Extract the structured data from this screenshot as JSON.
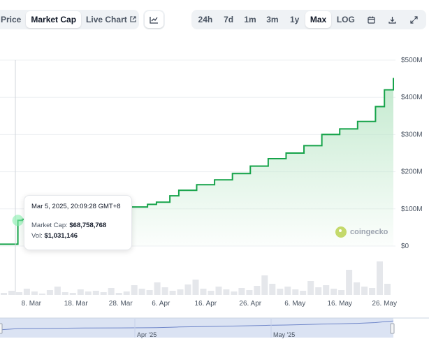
{
  "toolbar": {
    "left_tabs": [
      "Price",
      "Market Cap",
      "Live Chart"
    ],
    "active_left": "Market Cap",
    "ranges": [
      "24h",
      "7d",
      "1m",
      "3m",
      "1y",
      "Max",
      "LOG"
    ],
    "active_range": "Max",
    "icons": [
      "line-chart-icon",
      "calendar-icon",
      "download-icon",
      "expand-icon"
    ]
  },
  "tooltip": {
    "date": "Mar 5, 2025, 20:09:28 GMT+8",
    "market_cap_label": "Market Cap:",
    "market_cap_value": "$68,758,768",
    "vol_label": "Vol:",
    "vol_value": "$1,031,146"
  },
  "watermark": "coingecko",
  "colors": {
    "line": "#16a34a",
    "fill_top": "#bfe8cb",
    "volume": "#e5e7eb",
    "navigator": "#dbe3f3",
    "navigator_line": "#6f86c9"
  },
  "chart_data": {
    "type": "area",
    "title": "",
    "xlabel": "",
    "ylabel": "",
    "y_ticks": [
      "$500M",
      "$400M",
      "$300M",
      "$200M",
      "$100M",
      "$0"
    ],
    "x_ticks": [
      "8. Mar",
      "18. Mar",
      "28. Mar",
      "6. Apr",
      "16. Apr",
      "26. Apr",
      "6. May",
      "16. May",
      "26. May"
    ],
    "navigator_labels": [
      "Apr '25",
      "May '25"
    ],
    "ylim": [
      0,
      500
    ],
    "units": "USD millions",
    "x": [
      "2025-03-01",
      "2025-03-05",
      "2025-03-06",
      "2025-03-12",
      "2025-03-20",
      "2025-03-28",
      "2025-04-03",
      "2025-04-05",
      "2025-04-08",
      "2025-04-10",
      "2025-04-14",
      "2025-04-18",
      "2025-04-22",
      "2025-04-26",
      "2025-04-30",
      "2025-05-04",
      "2025-05-08",
      "2025-05-12",
      "2025-05-16",
      "2025-05-20",
      "2025-05-24",
      "2025-05-26",
      "2025-05-28"
    ],
    "values": [
      5,
      69,
      72,
      80,
      95,
      105,
      112,
      118,
      135,
      150,
      165,
      178,
      195,
      215,
      235,
      250,
      270,
      300,
      315,
      335,
      375,
      420,
      452
    ],
    "grid": true,
    "legend": "none"
  }
}
